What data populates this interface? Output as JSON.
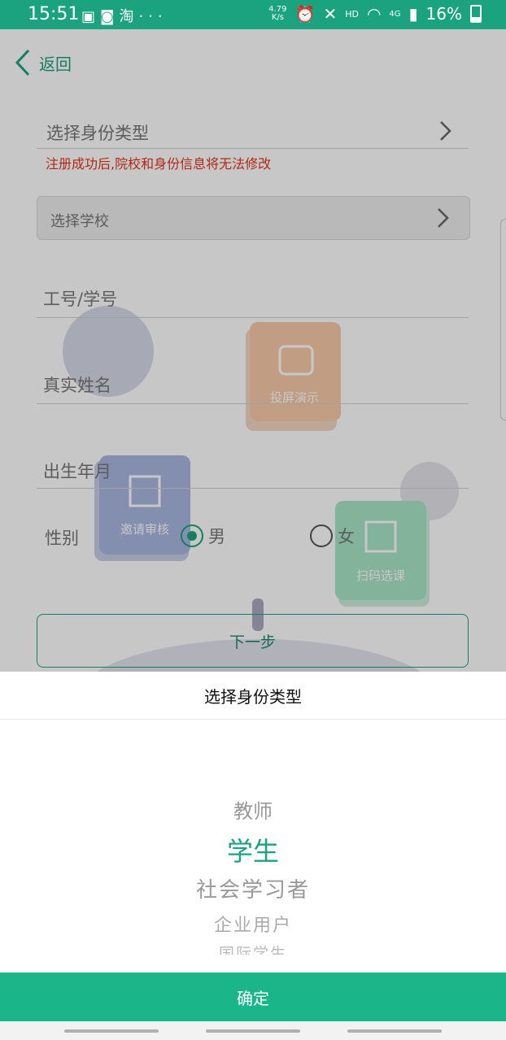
{
  "status_bar": {
    "time": "15:51",
    "net_speed_value": "4.79",
    "net_speed_unit": "K/s",
    "hd": "HD",
    "network": "4G",
    "battery": "16%"
  },
  "header": {
    "back_label": "返回"
  },
  "form": {
    "identity_placeholder": "选择身份类型",
    "warning": "注册成功后,院校和身份信息将无法修改",
    "school_placeholder": "选择学校",
    "id_placeholder": "工号/学号",
    "name_placeholder": "真实姓名",
    "birth_placeholder": "出生年月",
    "gender_label": "性别",
    "gender_male": "男",
    "gender_female": "女",
    "gender_selected": "男",
    "next_label": "下一步"
  },
  "background_cards": {
    "screen_cast": "投屏演示",
    "invite_review": "邀请审核",
    "scan_select": "扫码选课"
  },
  "picker": {
    "title": "选择身份类型",
    "options": [
      "教师",
      "学生",
      "社会学习者",
      "企业用户",
      "国际学生"
    ],
    "selected": "学生",
    "confirm_label": "确定"
  },
  "colors": {
    "accent": "#1aa37e",
    "confirm_bg": "#1ab68a",
    "warning": "#e2341d"
  }
}
